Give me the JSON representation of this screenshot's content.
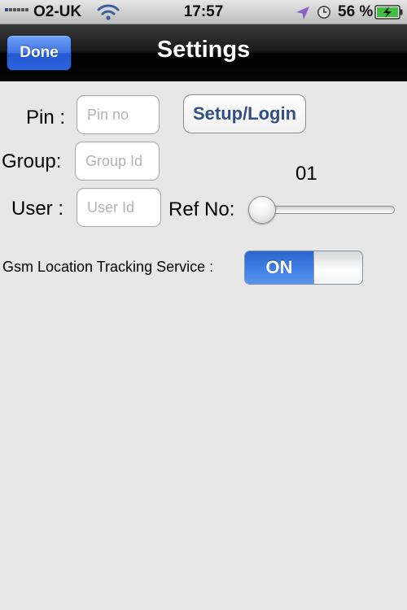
{
  "status_bar": {
    "carrier": "O2-UK",
    "time": "17:57",
    "battery_percent": "56 %",
    "icons": [
      "signal-bars-icon",
      "wifi-icon",
      "location-arrow-icon",
      "clock-icon",
      "battery-charging-icon"
    ]
  },
  "nav_bar": {
    "done_label": "Done",
    "title": "Settings"
  },
  "form": {
    "pin_label": "Pin :",
    "pin_placeholder": "Pin no",
    "group_label": "Group:",
    "group_placeholder": "Group Id",
    "user_label": "User :",
    "user_placeholder": "User Id",
    "setup_login_label": "Setup/Login",
    "ref_label": "Ref No:",
    "ref_value": "01",
    "ref_slider_fraction": 0
  },
  "gsm": {
    "label": "Gsm Location Tracking Service :",
    "toggle_label": "ON",
    "enabled": true
  },
  "colors": {
    "background": "#e7e7e7",
    "nav_bar": "#111111",
    "done_button": "#3e76e6",
    "button_text": "#324f85",
    "toggle_on": "#3f7fe5",
    "location_icon": "#8a5cc8",
    "battery_fill": "#3fbf3f"
  }
}
